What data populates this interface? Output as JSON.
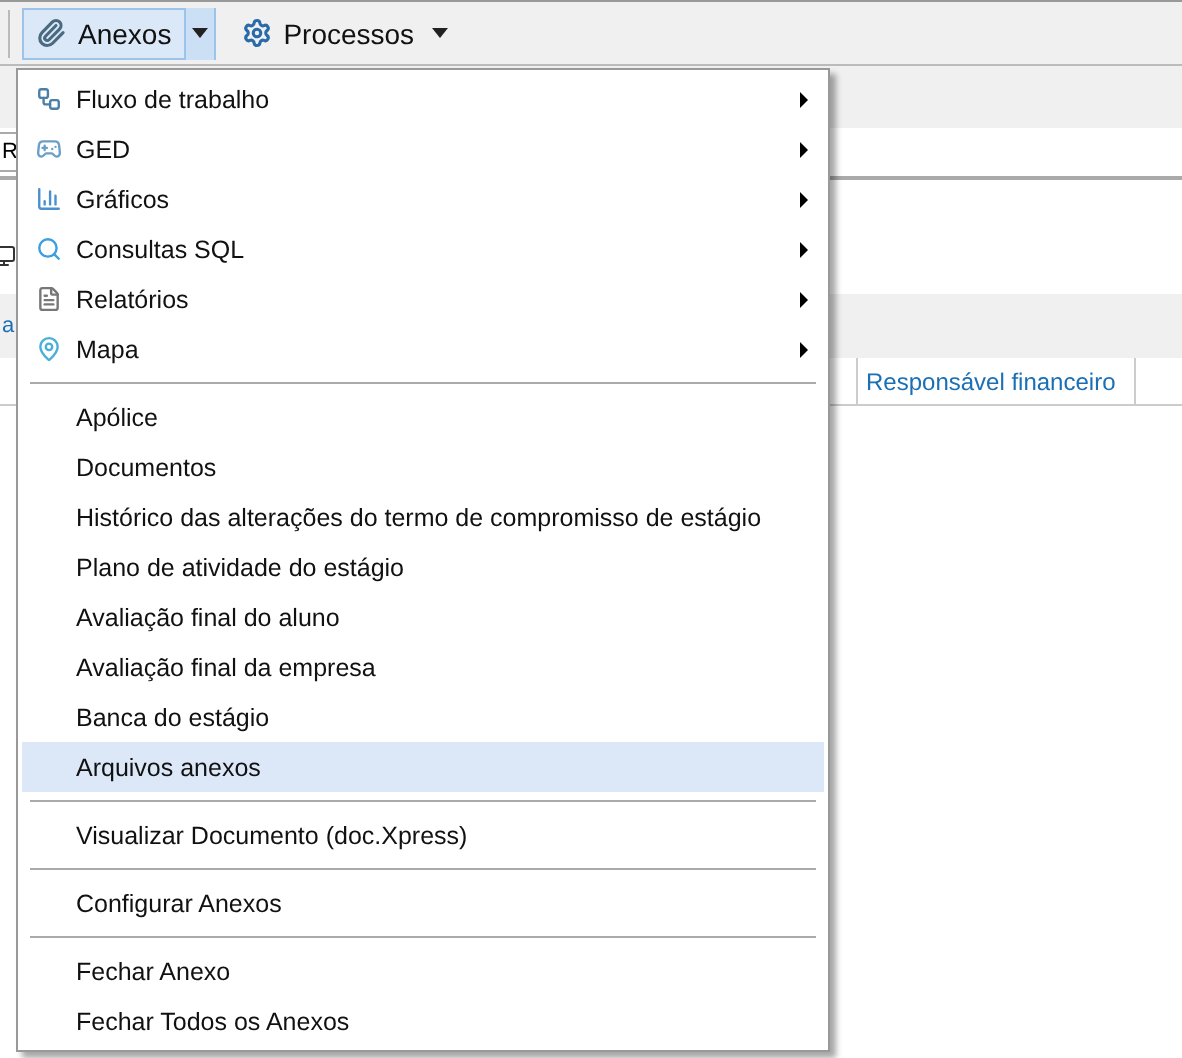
{
  "toolbar": {
    "buttons": [
      {
        "label": "Anexos",
        "pressed": true,
        "split": true
      },
      {
        "label": "Processos",
        "pressed": false,
        "split": false
      }
    ]
  },
  "background": {
    "field_text": "R",
    "link_text": "a",
    "column_2": "Responsável financeiro"
  },
  "menu": {
    "groups": [
      [
        {
          "label": "Fluxo de trabalho",
          "submenu": true,
          "selected": false
        },
        {
          "label": "GED",
          "submenu": true,
          "selected": false
        },
        {
          "label": "Gráficos",
          "submenu": true,
          "selected": false
        },
        {
          "label": "Consultas SQL",
          "submenu": true,
          "selected": false
        },
        {
          "label": "Relatórios",
          "submenu": true,
          "selected": false
        },
        {
          "label": "Mapa",
          "submenu": true,
          "selected": false
        }
      ],
      [
        {
          "label": "Apólice",
          "submenu": false,
          "selected": false
        },
        {
          "label": "Documentos",
          "submenu": false,
          "selected": false
        },
        {
          "label": "Histórico das alterações do termo de compromisso de estágio",
          "submenu": false,
          "selected": false
        },
        {
          "label": "Plano de atividade do estágio",
          "submenu": false,
          "selected": false
        },
        {
          "label": "Avaliação final do aluno",
          "submenu": false,
          "selected": false
        },
        {
          "label": "Avaliação final da empresa",
          "submenu": false,
          "selected": false
        },
        {
          "label": "Banca do estágio",
          "submenu": false,
          "selected": false
        },
        {
          "label": "Arquivos anexos",
          "submenu": false,
          "selected": true
        }
      ],
      [
        {
          "label": "Visualizar Documento (doc.Xpress)",
          "submenu": false,
          "selected": false
        }
      ],
      [
        {
          "label": "Configurar Anexos",
          "submenu": false,
          "selected": false
        }
      ],
      [
        {
          "label": "Fechar Anexo",
          "submenu": false,
          "selected": false
        },
        {
          "label": "Fechar Todos os Anexos",
          "submenu": false,
          "selected": false
        }
      ]
    ]
  }
}
